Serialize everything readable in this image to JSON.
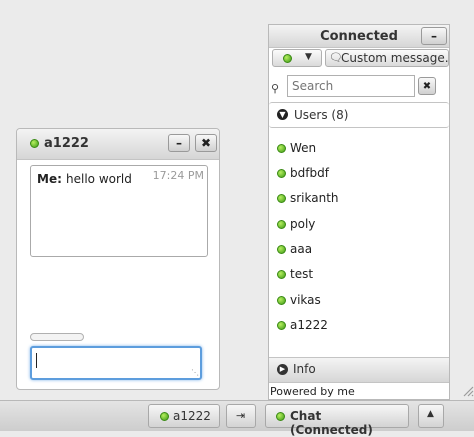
{
  "chat_window": {
    "title": "a1222",
    "minimize_icon": "minus-icon",
    "close_icon": "close-icon",
    "messages": [
      {
        "sender": "Me:",
        "text": "hello world",
        "time": "17:24 PM"
      }
    ],
    "reply_value": ""
  },
  "panel": {
    "title": "Connected",
    "minimize_icon": "minus-icon",
    "status_icon": "online-dot-icon",
    "custom_message": "Custom message...",
    "search_placeholder": "Search",
    "users_header": "Users (8)",
    "users": [
      {
        "name": "Wen",
        "status": "online"
      },
      {
        "name": "bdfbdf",
        "status": "online"
      },
      {
        "name": "srikanth",
        "status": "online"
      },
      {
        "name": "poly",
        "status": "online"
      },
      {
        "name": "aaa",
        "status": "online"
      },
      {
        "name": "test",
        "status": "online"
      },
      {
        "name": "vikas",
        "status": "online"
      },
      {
        "name": "a1222",
        "status": "online"
      }
    ],
    "info_label": "Info",
    "powered_by": "Powered by me"
  },
  "taskbar": {
    "chat_tab": "a1222",
    "chat_main": "Chat (Connected)"
  },
  "colors": {
    "online": "#3d9a16",
    "focus_border": "#5d9ddd",
    "background": "#ebebeb"
  }
}
